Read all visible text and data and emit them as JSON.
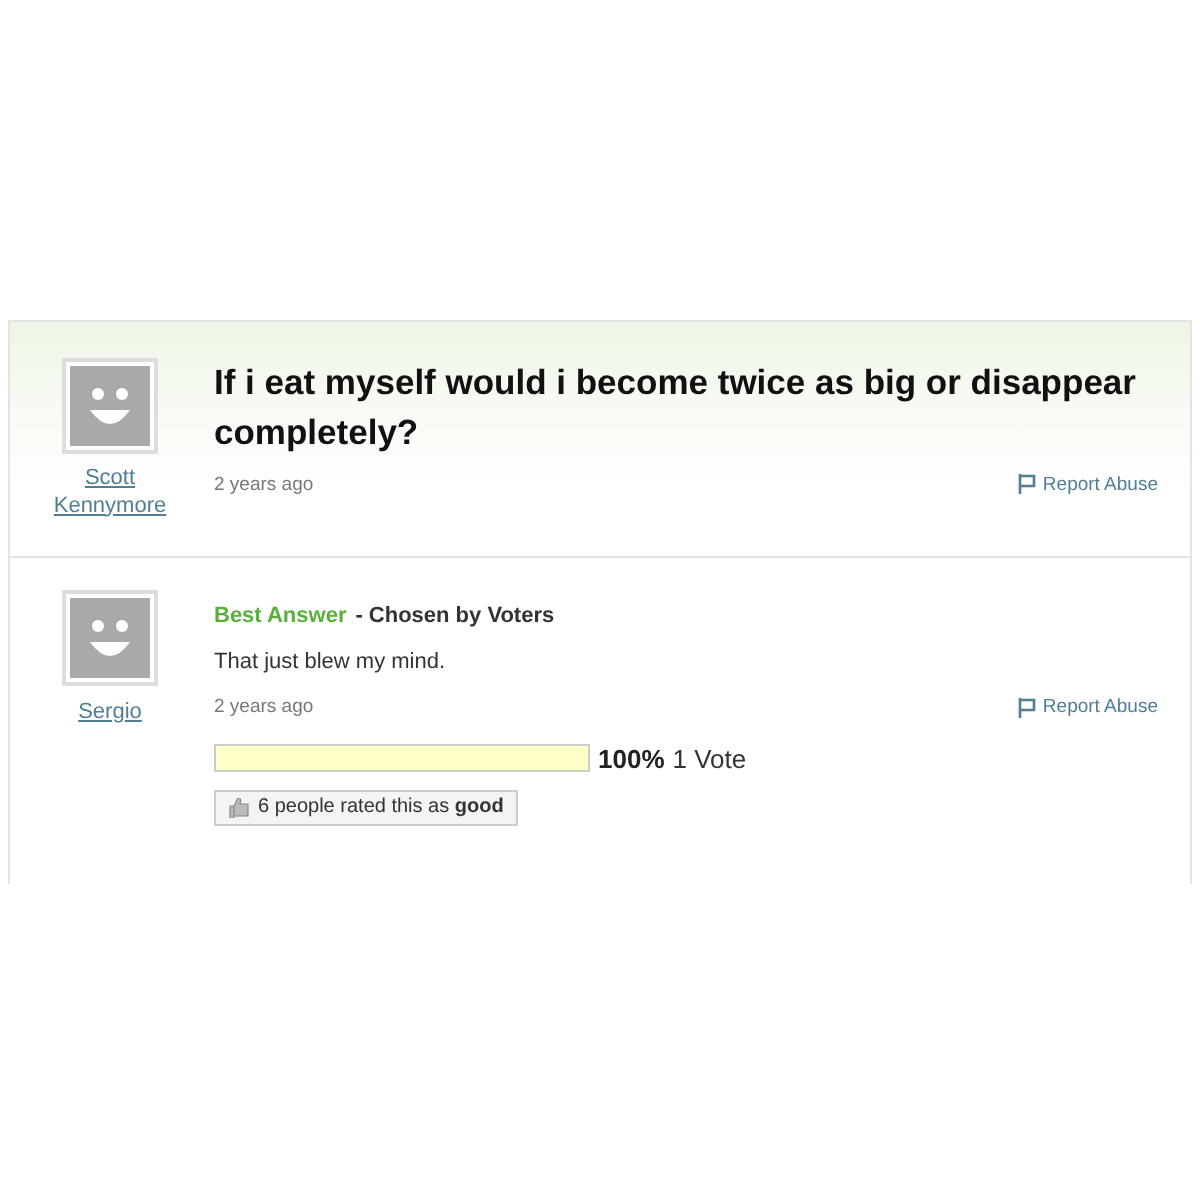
{
  "question": {
    "author": "Scott Kennymore",
    "title": "If i eat myself would i become twice as big or disappear completely?",
    "time": "2 years ago",
    "report": "Report Abuse"
  },
  "answer": {
    "author": "Sergio",
    "badge": "Best Answer",
    "chosen": "- Chosen by Voters",
    "text": "That just blew my mind.",
    "time": "2 years ago",
    "report": "Report Abuse",
    "vote": {
      "level": 1.0,
      "percent": "100%",
      "count": "1 Vote"
    },
    "rating": "6 people rated this as **good**"
  }
}
